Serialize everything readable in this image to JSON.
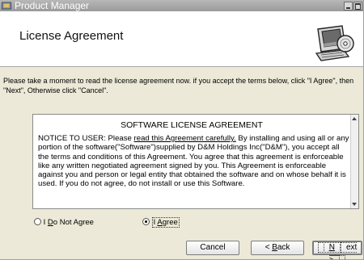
{
  "window": {
    "title": "Product Manager"
  },
  "header": {
    "title": "License Agreement",
    "graphic_icon": "computer-disc-icon"
  },
  "intro": {
    "text": "Please take a moment to read the license agreement now. if you accept the terms below, click \"I Agree\", then \"Next\", Otherwise click \"Cancel\"."
  },
  "license": {
    "heading": "SOFTWARE LICENSE AGREEMENT",
    "body_prefix": "NOTICE TO USER: Please ",
    "body_underlined": "read this Agreement carefully.",
    "body_rest": " By installing and using all or any portion of the software(\"Software\")supplied by D&M Holdings Inc(\"D&M\"), you accept all the terms and conditions of this Agreement. You agree that this agreement is enforceable like any written negotiated agreement signed by you. This Agreement is enforceable against you and person or legal entity that obtained the software and on whose behalf it is used. If you do not agree,  do not install or use this Software."
  },
  "choice": {
    "decline_label_prefix": "I ",
    "decline_label_mnemonic": "D",
    "decline_label_rest": "o Not Agree",
    "agree_label_prefix": "I ",
    "agree_label_mnemonic": "A",
    "agree_label_rest": "gree",
    "selected": "agree"
  },
  "buttons": {
    "cancel": "Cancel",
    "back_prefix": "< ",
    "back_mnemonic": "B",
    "back_rest": "ack",
    "next_mnemonic": "N",
    "next_rest": "ext >"
  },
  "colors": {
    "window_bg": "#ece9d8",
    "titlebar": "#a8a8a8",
    "header_bg": "#ffffff"
  }
}
